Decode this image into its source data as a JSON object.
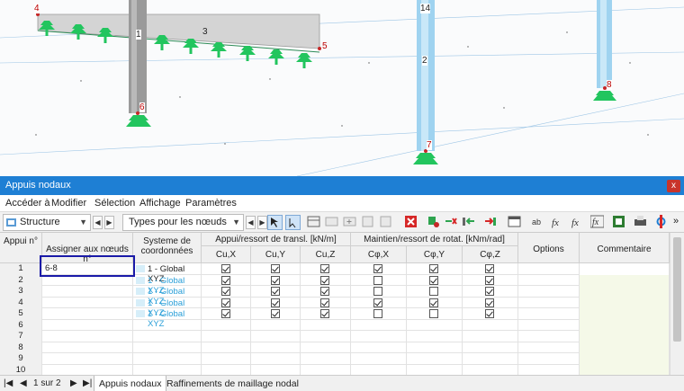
{
  "viewport": {
    "node_labels": [
      "4",
      "1",
      "3",
      "5",
      "6",
      "14",
      "2",
      "7",
      "8"
    ]
  },
  "window": {
    "title": "Appuis nodaux",
    "close_label": "x",
    "menu": [
      "Accéder à",
      "Modifier",
      "Sélection",
      "Affichage",
      "Paramètres"
    ]
  },
  "toolbar": {
    "structure_label": "Structure",
    "types_label": "Types pour les nœuds",
    "more_label": "»"
  },
  "table": {
    "col_appui": "Appui n°",
    "col_assign": "Assigner aux nœuds n°",
    "col_sys": "Systeme de coordonnées",
    "group_transl": "Appui/ressort de transl. [kN/m]",
    "group_rot": "Maintien/ressort de rotat. [kNm/rad]",
    "col_options": "Options",
    "col_comment": "Commentaire",
    "sub_cols": [
      "Cu,X",
      "Cu,Y",
      "Cu,Z",
      "Cφ,X",
      "Cφ,Y",
      "Cφ,Z"
    ],
    "rows": [
      {
        "num": "1",
        "assign": "6-8",
        "sys": "1 - Global XYZ",
        "checks": [
          true,
          true,
          true,
          true,
          true,
          true
        ]
      },
      {
        "num": "2",
        "assign": "",
        "sys": "1 - Global XYZ",
        "checks": [
          true,
          true,
          true,
          false,
          true,
          true
        ]
      },
      {
        "num": "3",
        "assign": "",
        "sys": "1 - Global XYZ",
        "checks": [
          true,
          true,
          true,
          false,
          false,
          true
        ]
      },
      {
        "num": "4",
        "assign": "",
        "sys": "1 - Global XYZ",
        "checks": [
          true,
          true,
          true,
          true,
          true,
          true
        ]
      },
      {
        "num": "5",
        "assign": "",
        "sys": "1 - Global XYZ",
        "checks": [
          true,
          true,
          true,
          false,
          false,
          true
        ]
      },
      {
        "num": "6",
        "assign": "",
        "sys": "",
        "checks": []
      },
      {
        "num": "7",
        "assign": "",
        "sys": "",
        "checks": []
      },
      {
        "num": "8",
        "assign": "",
        "sys": "",
        "checks": []
      },
      {
        "num": "9",
        "assign": "",
        "sys": "",
        "checks": []
      },
      {
        "num": "10",
        "assign": "",
        "sys": "",
        "checks": []
      }
    ]
  },
  "tabs": {
    "page_label": "1 sur 2",
    "items": [
      "Appuis nodaux",
      "Raffinements de maillage nodal"
    ]
  },
  "colors": {
    "titlebar": "#1e7fd4",
    "support_green": "#22c55e",
    "column_blue": "#9fd3f0",
    "highlight_border": "#1a1aa8"
  }
}
